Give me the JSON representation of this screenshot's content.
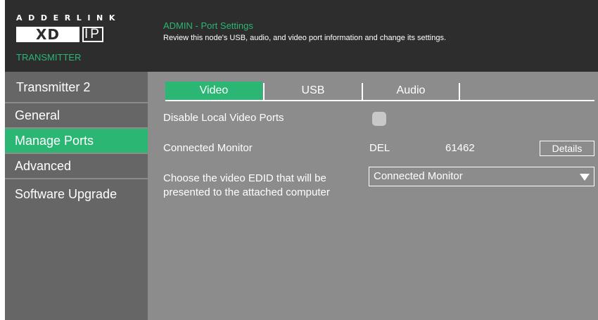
{
  "brand": {
    "top": "ADDERLINK",
    "mark_xd": "XD",
    "mark_ip": "IP",
    "sub": "TRANSMITTER"
  },
  "header": {
    "title": "ADMIN - Port Settings",
    "description": "Review this node's USB, audio, and video port information and change its settings."
  },
  "sidebar": {
    "device_name": "Transmitter 2",
    "items": [
      {
        "label": "General",
        "active": false
      },
      {
        "label": "Manage Ports",
        "active": true
      },
      {
        "label": "Advanced",
        "active": false
      },
      {
        "label": "Software Upgrade",
        "active": false
      }
    ]
  },
  "tabs": [
    {
      "label": "Video",
      "active": true
    },
    {
      "label": "USB",
      "active": false
    },
    {
      "label": "Audio",
      "active": false
    }
  ],
  "video": {
    "disable_local_label": "Disable Local Video Ports",
    "disable_local_checked": false,
    "connected_monitor_label": "Connected Monitor",
    "monitor_vendor": "DEL",
    "monitor_id": "61462",
    "details_button": "Details",
    "edid_label_line1": "Choose the video EDID that will be",
    "edid_label_line2": "presented to the attached computer",
    "edid_selected": "Connected Monitor"
  },
  "colors": {
    "accent": "#2bb673",
    "header_bg": "#2d2d2d",
    "sidebar_bg": "#666666",
    "content_bg": "#8c8c8c"
  }
}
